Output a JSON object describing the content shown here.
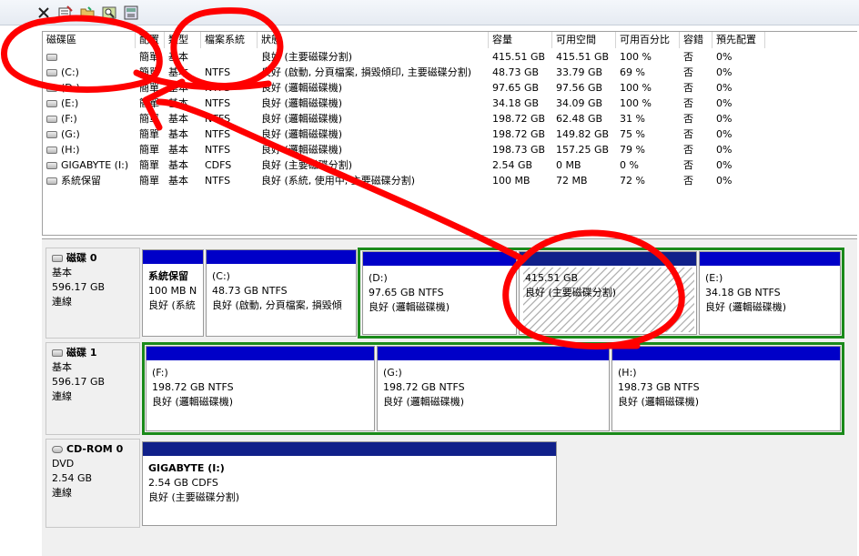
{
  "toolbar": {
    "icons": [
      "close-icon",
      "properties-icon",
      "folder-open-icon",
      "search-icon",
      "help-icon"
    ]
  },
  "list": {
    "headers": [
      "磁碟區",
      "配置",
      "類型",
      "檔案系統",
      "狀態",
      "容量",
      "可用空間",
      "可用百分比",
      "容錯",
      "預先配置"
    ],
    "rows": [
      {
        "volume": "",
        "layout": "簡單",
        "type": "基本",
        "fs": "",
        "status": "良好 (主要磁碟分割)",
        "capacity": "415.51 GB",
        "free": "415.51 GB",
        "pct": "100 %",
        "ft": "否",
        "overhead": "0%"
      },
      {
        "volume": "(C:)",
        "layout": "簡單",
        "type": "基本",
        "fs": "NTFS",
        "status": "良好 (啟動, 分頁檔案, 損毀傾印, 主要磁碟分割)",
        "capacity": "48.73 GB",
        "free": "33.79 GB",
        "pct": "69 %",
        "ft": "否",
        "overhead": "0%"
      },
      {
        "volume": "(D:)",
        "layout": "簡單",
        "type": "基本",
        "fs": "NTFS",
        "status": "良好 (邏輯磁碟機)",
        "capacity": "97.65 GB",
        "free": "97.56 GB",
        "pct": "100 %",
        "ft": "否",
        "overhead": "0%"
      },
      {
        "volume": "(E:)",
        "layout": "簡單",
        "type": "基本",
        "fs": "NTFS",
        "status": "良好 (邏輯磁碟機)",
        "capacity": "34.18 GB",
        "free": "34.09 GB",
        "pct": "100 %",
        "ft": "否",
        "overhead": "0%"
      },
      {
        "volume": "(F:)",
        "layout": "簡單",
        "type": "基本",
        "fs": "NTFS",
        "status": "良好 (邏輯磁碟機)",
        "capacity": "198.72 GB",
        "free": "62.48 GB",
        "pct": "31 %",
        "ft": "否",
        "overhead": "0%"
      },
      {
        "volume": "(G:)",
        "layout": "簡單",
        "type": "基本",
        "fs": "NTFS",
        "status": "良好 (邏輯磁碟機)",
        "capacity": "198.72 GB",
        "free": "149.82 GB",
        "pct": "75 %",
        "ft": "否",
        "overhead": "0%"
      },
      {
        "volume": "(H:)",
        "layout": "簡單",
        "type": "基本",
        "fs": "NTFS",
        "status": "良好 (邏輯磁碟機)",
        "capacity": "198.73 GB",
        "free": "157.25 GB",
        "pct": "79 %",
        "ft": "否",
        "overhead": "0%"
      },
      {
        "volume": "GIGABYTE (I:)",
        "layout": "簡單",
        "type": "基本",
        "fs": "CDFS",
        "status": "良好 (主要磁碟分割)",
        "capacity": "2.54 GB",
        "free": "0 MB",
        "pct": "0 %",
        "ft": "否",
        "overhead": "0%"
      },
      {
        "volume": "系統保留",
        "layout": "簡單",
        "type": "基本",
        "fs": "NTFS",
        "status": "良好 (系統, 使用中, 主要磁碟分割)",
        "capacity": "100 MB",
        "free": "72 MB",
        "pct": "72 %",
        "ft": "否",
        "overhead": "0%"
      }
    ]
  },
  "disks": [
    {
      "name": "磁碟 0",
      "type": "基本",
      "size": "596.17 GB",
      "state": "連線",
      "volumes": [
        {
          "name": "系統保留",
          "line2": "100 MB N",
          "line3": "良好 (系統"
        },
        {
          "name": "(C:)",
          "line2": "48.73 GB NTFS",
          "line3": "良好 (啟動, 分頁檔案, 損毀傾"
        },
        {
          "name": "(D:)",
          "line2": "97.65 GB NTFS",
          "line3": "良好 (邏輯磁碟機)"
        },
        {
          "name": "",
          "line2": "415.51 GB",
          "line3": "良好 (主要磁碟分割)"
        },
        {
          "name": "(E:)",
          "line2": "34.18 GB NTFS",
          "line3": "良好 (邏輯磁碟機)"
        }
      ]
    },
    {
      "name": "磁碟 1",
      "type": "基本",
      "size": "596.17 GB",
      "state": "連線",
      "volumes": [
        {
          "name": "(F:)",
          "line2": "198.72 GB NTFS",
          "line3": "良好 (邏輯磁碟機)"
        },
        {
          "name": "(G:)",
          "line2": "198.72 GB NTFS",
          "line3": "良好 (邏輯磁碟機)"
        },
        {
          "name": "(H:)",
          "line2": "198.73 GB NTFS",
          "line3": "良好 (邏輯磁碟機)"
        }
      ]
    },
    {
      "name": "CD-ROM 0",
      "type": "DVD",
      "size": "2.54 GB",
      "state": "連線",
      "volumes": [
        {
          "name": "GIGABYTE  (I:)",
          "line2": "2.54 GB CDFS",
          "line3": "良好 (主要磁碟分割)"
        }
      ]
    }
  ],
  "colors": {
    "primary_bar": "#0000c8",
    "logical_bar": "#0000c8",
    "extended_border": "#1a8a1a",
    "cdrom_bar": "#10208a",
    "annotation": "#ff0000"
  }
}
